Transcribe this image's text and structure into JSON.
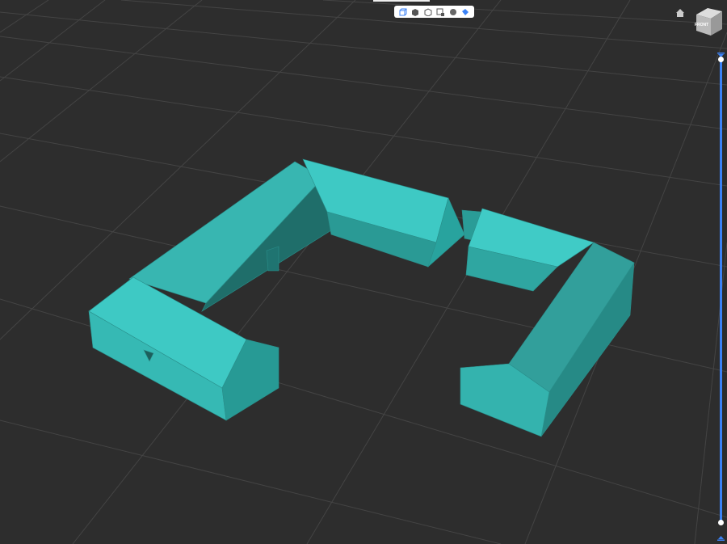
{
  "viewer": {
    "toolbar": {
      "tools": [
        {
          "icon": "perspective-cube-icon",
          "active": true
        },
        {
          "icon": "solid-cube-icon",
          "active": false
        },
        {
          "icon": "wireframe-cube-icon",
          "active": false
        },
        {
          "icon": "section-box-icon",
          "active": false
        },
        {
          "icon": "sphere-material-icon",
          "active": false
        },
        {
          "icon": "paint-bucket-icon",
          "active": true
        }
      ]
    },
    "view_cube": {
      "face_label": "FRONT"
    },
    "model_color": "#3ec9c4",
    "accent_color": "#3b82f6",
    "slider": {
      "top_value": 0,
      "bottom_value": 1
    }
  }
}
